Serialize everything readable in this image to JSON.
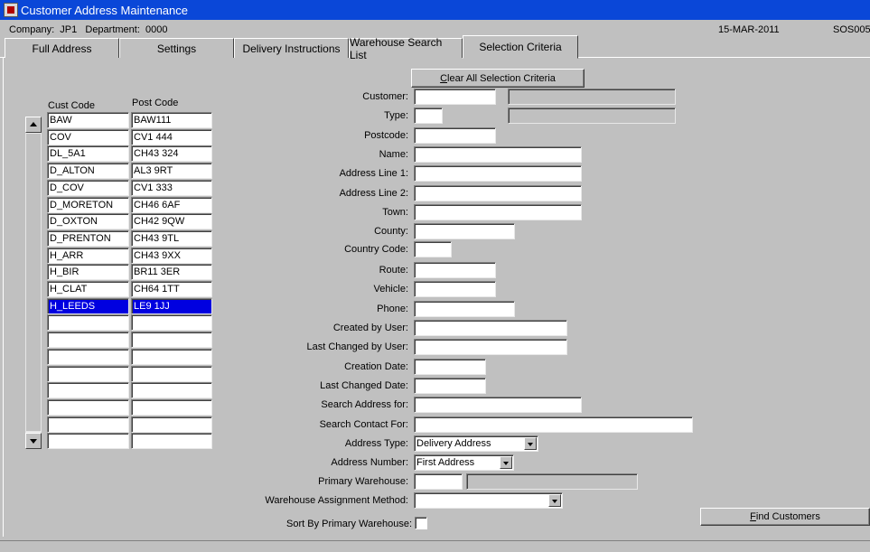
{
  "window": {
    "title": "Customer Address Maintenance",
    "icon": "oracle-forms-icon"
  },
  "info": {
    "company": "Company:  JP1   Department:  0000",
    "date": "15-MAR-2011",
    "form_code": "SOS005"
  },
  "tabs": [
    {
      "label": "Full Address"
    },
    {
      "label": "Settings"
    },
    {
      "label": "Delivery Instructions"
    },
    {
      "label": "Warehouse Search List"
    },
    {
      "label": "Selection Criteria",
      "active": true
    }
  ],
  "list": {
    "headers": {
      "cust_code": "Cust Code",
      "post_code": "Post Code"
    },
    "rows": [
      {
        "cust": "BAW",
        "post": "BAW111"
      },
      {
        "cust": "COV",
        "post": "CV1 444"
      },
      {
        "cust": "DL_5A1",
        "post": "CH43 324"
      },
      {
        "cust": "D_ALTON",
        "post": "AL3 9RT"
      },
      {
        "cust": "D_COV",
        "post": "CV1 333"
      },
      {
        "cust": "D_MORETON",
        "post": "CH46 6AF"
      },
      {
        "cust": "D_OXTON",
        "post": "CH42 9QW"
      },
      {
        "cust": "D_PRENTON",
        "post": "CH43 9TL"
      },
      {
        "cust": "H_ARR",
        "post": "CH43 9XX"
      },
      {
        "cust": "H_BIR",
        "post": "BR11 3ER"
      },
      {
        "cust": "H_CLAT",
        "post": "CH64 1TT"
      },
      {
        "cust": "H_LEEDS",
        "post": "LE9 1JJ",
        "selected": true
      },
      {
        "cust": "",
        "post": ""
      },
      {
        "cust": "",
        "post": ""
      },
      {
        "cust": "",
        "post": ""
      },
      {
        "cust": "",
        "post": ""
      },
      {
        "cust": "",
        "post": ""
      },
      {
        "cust": "",
        "post": ""
      },
      {
        "cust": "",
        "post": ""
      },
      {
        "cust": "",
        "post": ""
      }
    ]
  },
  "criteria": {
    "clear_button": {
      "mnemonic": "C",
      "rest": "lear All Selection Criteria"
    },
    "labels": {
      "customer": "Customer:",
      "type": "Type:",
      "postcode": "Postcode:",
      "name": "Name:",
      "address_line_1": "Address Line 1:",
      "address_line_2": "Address Line 2:",
      "town": "Town:",
      "county": "County:",
      "country_code": "Country Code:",
      "route": "Route:",
      "vehicle": "Vehicle:",
      "phone": "Phone:",
      "created_by_user": "Created by User:",
      "last_changed_by_user": "Last Changed by User:",
      "creation_date": "Creation Date:",
      "last_changed_date": "Last Changed Date:",
      "search_address_for": "Search Address for:",
      "search_contact_for": "Search Contact For:",
      "address_type": "Address Type:",
      "address_number": "Address Number:",
      "primary_warehouse": "Primary Warehouse:",
      "warehouse_assignment_method": "Warehouse Assignment Method:",
      "sort_by_primary_warehouse": "Sort By Primary Warehouse:"
    },
    "values": {
      "address_type": "Delivery Address",
      "address_number": "First Address",
      "warehouse_assignment_method": ""
    },
    "find_button": {
      "mnemonic": "F",
      "rest": "ind Customers"
    }
  }
}
